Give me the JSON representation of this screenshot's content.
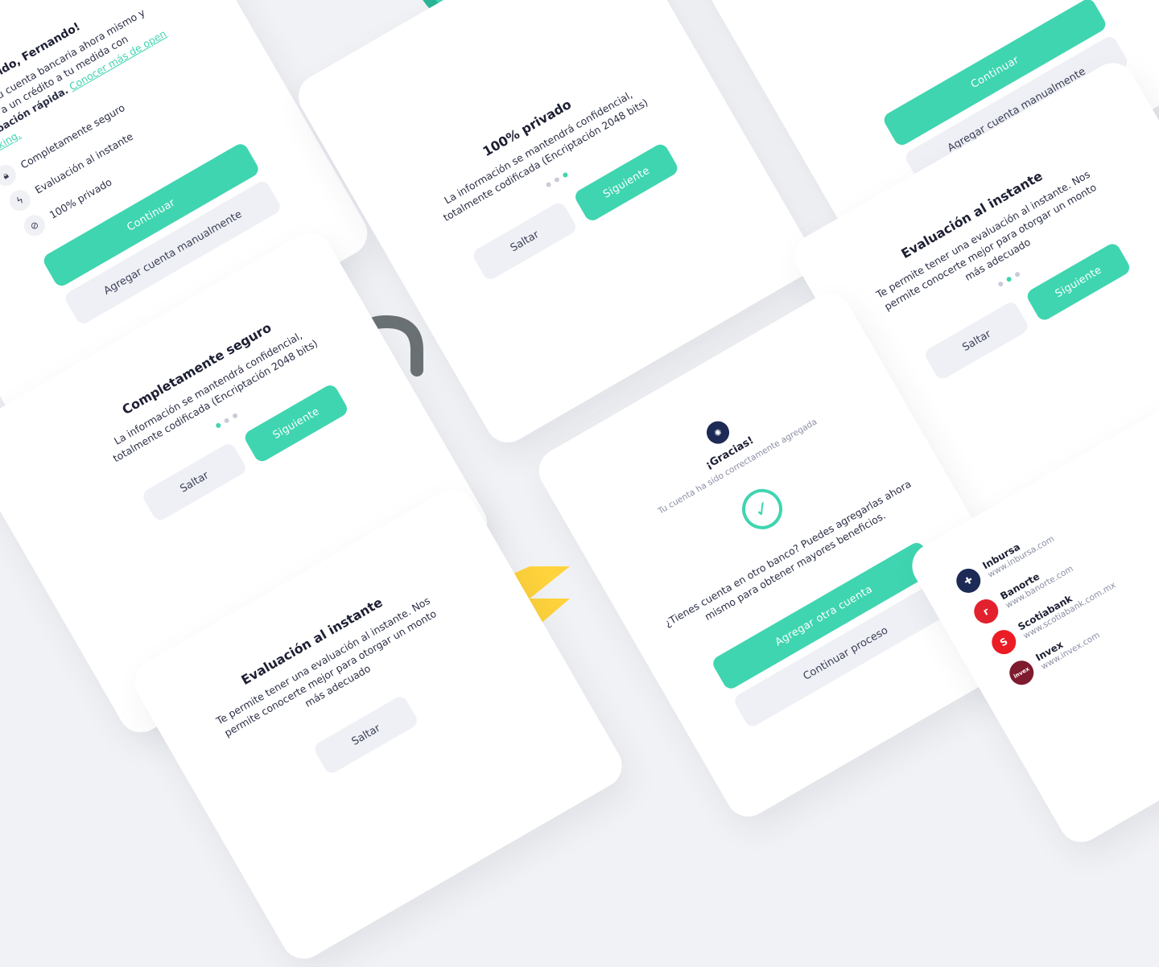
{
  "colors": {
    "accent": "#3fd5b0",
    "text_dark": "#1d2033",
    "muted": "#8a8fa3",
    "secondary_btn": "#eef0f5",
    "lock_body": "#f7c530",
    "lock_shackle": "#6b7275",
    "bolt": "#ffd33b"
  },
  "welcome_card": {
    "greeting": "¡Bienvenido, Fernando!",
    "intro": "Agrega tu cuenta bancaria ahora mismo y accede a un crédito a tu medida con",
    "intro_bold": "aprobación rápida.",
    "learn_more_link": "Conocer más de open banking.",
    "features": [
      {
        "icon": "lock-icon",
        "label": "Completamente seguro"
      },
      {
        "icon": "bolt-icon",
        "label": "Evaluación al instante"
      },
      {
        "icon": "eye-off-icon",
        "label": "100% privado"
      }
    ],
    "continue_label": "Continuar",
    "manual_label": "Agregar cuenta manualmente"
  },
  "private_card": {
    "title": "100% privado",
    "description": "La información se mantendrá confidencial, totalmente codificada (Encriptación 2048 bits)",
    "next_label": "Siguiente",
    "skip_label": "Saltar",
    "active_step": 3
  },
  "top_right_card": {
    "continue_label": "Continuar",
    "manual_label": "Agregar cuenta manualmente"
  },
  "secure_card": {
    "title": "Completamente seguro",
    "description": "La información se mantendrá confidencial, totalmente codificada (Encriptación 2048 bits)",
    "next_label": "Siguiente",
    "skip_label": "Saltar",
    "active_step": 1
  },
  "instant_card_right": {
    "title": "Evaluación al instante",
    "description": "Te permite tener una evaluación al instante. Nos permite conocerte mejor para otorgar un monto más adecuado",
    "next_label": "Siguiente",
    "skip_label": "Saltar",
    "active_step": 2
  },
  "thanks_card": {
    "title": "¡Gracias!",
    "subtitle": "Tu cuenta ha sido correctamente agregada",
    "question": "¿Tienes cuenta en otro banco? Puedes agregarlas ahora mismo para obtener mayores beneficios.",
    "add_label": "Agregar otra cuenta",
    "continue_label": "Continuar proceso"
  },
  "instant_card_bottom": {
    "title": "Evaluación al instante",
    "description": "Te permite tener una evaluación al instante. Nos permite conocerte mejor para otorgar un monto más adecuado",
    "skip_label": "Saltar"
  },
  "banks_card": {
    "banks": [
      {
        "name": "Inbursa",
        "url": "www.inbursa.com",
        "logo_text": "✚",
        "color": "#1c2a55"
      },
      {
        "name": "Banorte",
        "url": "www.banorte.com",
        "logo_text": "ᴦ",
        "color": "#e3212e"
      },
      {
        "name": "Scotiabank",
        "url": "www.scotiabank.com.mx",
        "logo_text": "S",
        "color": "#ec1c24"
      },
      {
        "name": "Invex",
        "url": "www.invex.com",
        "logo_text": "invex",
        "color": "#7e1b2e"
      }
    ]
  }
}
